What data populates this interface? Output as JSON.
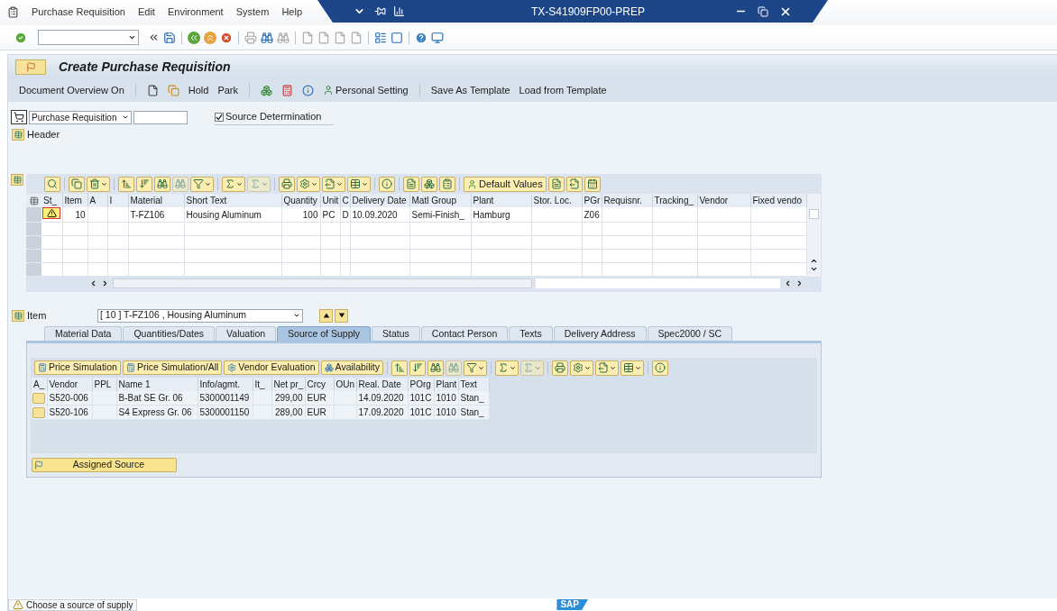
{
  "window": {
    "title": "TX-S41909FP00-PREP"
  },
  "menu": [
    "Purchase Requisition",
    "Edit",
    "Environment",
    "System",
    "Help"
  ],
  "screen_title": "Create Purchase Requisition",
  "app_toolbar": {
    "document_overview": "Document Overview On",
    "hold": "Hold",
    "park": "Park",
    "personal_setting": "Personal Setting",
    "save_template": "Save As Template",
    "load_template": "Load from Template"
  },
  "document_type": {
    "value": "Purchase Requisition"
  },
  "source_determination": {
    "label": "Source Determination",
    "checked": true
  },
  "header": {
    "label": "Header"
  },
  "items_toolbar": {
    "default_values": "Default Values"
  },
  "items_table": {
    "columns": [
      "St_",
      "Item",
      "A",
      "I",
      "Material",
      "Short Text",
      "Quantity",
      "Unit",
      "C",
      "Delivery Date",
      "Matl Group",
      "Plant",
      "Stor. Loc.",
      "PGr",
      "Requisnr.",
      "Tracking_",
      "Vendor",
      "Fixed vendo"
    ],
    "rows": [
      {
        "warning": true,
        "cells": [
          "",
          "10",
          "",
          "",
          "T-FZ106",
          "Housing Aluminum",
          "100",
          "PC",
          "D",
          "10.09.2020",
          "Semi-Finish_",
          "Hamburg",
          "",
          "Z06",
          "",
          "",
          "",
          ""
        ]
      }
    ]
  },
  "item_selector": {
    "label": "Item",
    "value": "[ 10 ] T-FZ106 , Housing Aluminum"
  },
  "tabs": [
    {
      "label": "Material Data",
      "selected": false
    },
    {
      "label": "Quantities/Dates",
      "selected": false
    },
    {
      "label": "Valuation",
      "selected": false
    },
    {
      "label": "Source of Supply",
      "selected": true
    },
    {
      "label": "Status",
      "selected": false
    },
    {
      "label": "Contact Person",
      "selected": false
    },
    {
      "label": "Texts",
      "selected": false
    },
    {
      "label": "Delivery Address",
      "selected": false
    },
    {
      "label": "Spec2000 / SC",
      "selected": false
    }
  ],
  "sources_toolbar": [
    "Price Simulation",
    "Price Simulation/All",
    "Vendor Evaluation",
    "Availability"
  ],
  "sources_table": {
    "columns": [
      "A_",
      "Vendor",
      "PPL",
      "Name 1",
      "Info/agmt.",
      "It_",
      "Net pr_",
      "Crcy",
      "OUn",
      "Real. Date",
      "POrg",
      "Plant",
      "Text"
    ],
    "rows": [
      [
        "",
        "S520-006",
        "",
        "B-Bat SE Gr. 06",
        "5300001149",
        "",
        "299,00",
        "EUR",
        "",
        "14.09.2020",
        "101C",
        "1010",
        "Stan_"
      ],
      [
        "",
        "S520-106",
        "",
        "S4 Express Gr. 06",
        "5300001150",
        "",
        "289,00",
        "EUR",
        "",
        "17.09.2020",
        "101C",
        "1010",
        "Stan_"
      ]
    ]
  },
  "assigned_source": "Assigned Source",
  "status_bar": {
    "warning": true,
    "message": "Choose a source of supply"
  },
  "logo": "SAP"
}
